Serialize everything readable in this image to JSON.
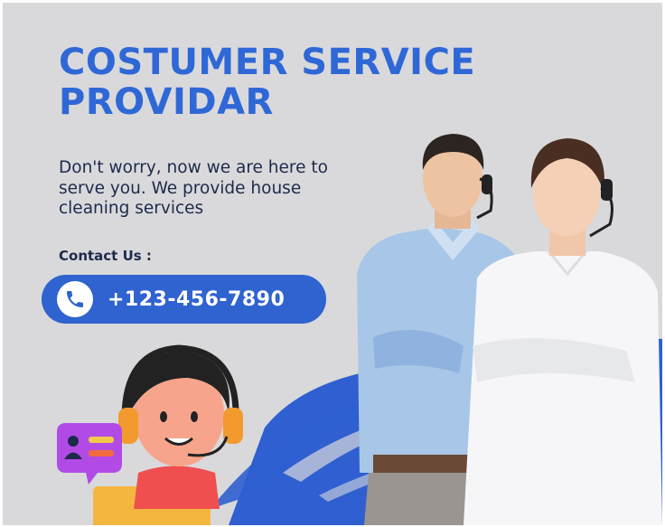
{
  "headline": {
    "line1": "COSTUMER SERVICE",
    "line2": "PROVIDAR"
  },
  "description": "Don't worry, now we are here to serve you. We provide house cleaning services",
  "contact": {
    "label": "Contact Us :",
    "phone": "+123-456-7890",
    "phone_icon": "phone-icon"
  },
  "colors": {
    "background": "#d9d9dc",
    "brand_blue": "#2f68d6",
    "text_dark": "#1d2a4a",
    "white": "#ffffff"
  },
  "illustration": {
    "people": [
      "male-agent-with-headset",
      "female-agent-with-headset"
    ],
    "cartoon": "agent-avatar-with-headset",
    "chat_badge": "contact-card-chat-icon"
  }
}
